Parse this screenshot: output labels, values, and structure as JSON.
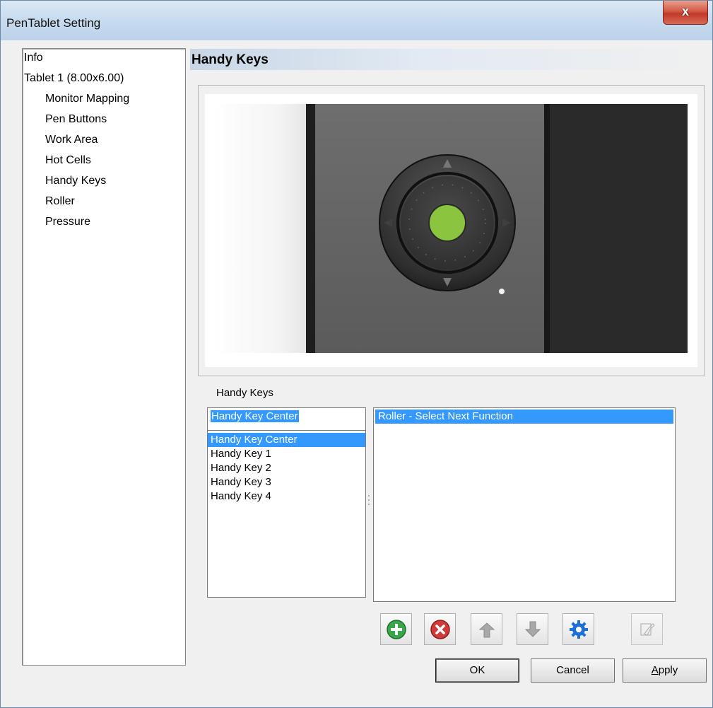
{
  "window": {
    "title": "PenTablet Setting",
    "close_glyph": "x"
  },
  "nav": {
    "items": [
      {
        "label": "Info",
        "level": 0
      },
      {
        "label": "Tablet 1 (8.00x6.00)",
        "level": 0
      },
      {
        "label": "Monitor Mapping",
        "level": 1
      },
      {
        "label": "Pen Buttons",
        "level": 1
      },
      {
        "label": "Work Area",
        "level": 1
      },
      {
        "label": "Hot Cells",
        "level": 1
      },
      {
        "label": "Handy Keys",
        "level": 1
      },
      {
        "label": "Roller",
        "level": 1
      },
      {
        "label": "Pressure",
        "level": 1
      }
    ]
  },
  "section": {
    "title": "Handy Keys"
  },
  "handy_keys": {
    "label": "Handy Keys",
    "name_field_value": "Handy Key Center",
    "items": [
      "Handy Key Center",
      "Handy Key 1",
      "Handy Key 2",
      "Handy Key 3",
      "Handy Key 4"
    ],
    "selected_index": 0
  },
  "functions": {
    "items": [
      "Roller - Select Next Function"
    ],
    "selected_index": 0
  },
  "toolbar": {
    "add_icon": "plus-circle-icon",
    "delete_icon": "x-circle-icon",
    "move_up_icon": "arrow-up-icon",
    "move_down_icon": "arrow-down-icon",
    "settings_icon": "gear-icon",
    "edit_icon": "hand-pointer-icon"
  },
  "buttons": {
    "ok": "OK",
    "cancel": "Cancel",
    "apply": "Apply"
  },
  "colors": {
    "selection": "#3399ff",
    "center_key": "#8bc53f",
    "close_button": "#c0392b"
  }
}
